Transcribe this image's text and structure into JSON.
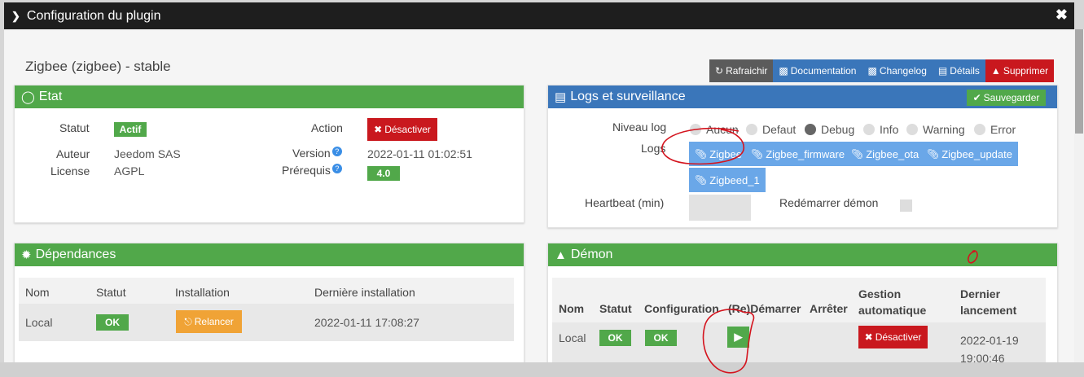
{
  "window": {
    "title": "Configuration du plugin",
    "close_icon": "close-icon"
  },
  "plugin": {
    "name": "Zigbee (zigbee) - stable"
  },
  "toolbar": {
    "refresh": "Rafraichir",
    "documentation": "Documentation",
    "changelog": "Changelog",
    "details": "Détails",
    "delete": "Supprimer"
  },
  "etat": {
    "title": "Etat",
    "statut_label": "Statut",
    "statut_value": "Actif",
    "auteur_label": "Auteur",
    "auteur_value": "Jeedom SAS",
    "license_label": "License",
    "license_value": "AGPL",
    "action_label": "Action",
    "action_button": "Désactiver",
    "version_label": "Version",
    "version_value": "2022-01-11 01:02:51",
    "prereq_label": "Prérequis",
    "prereq_value": "4.0"
  },
  "logs": {
    "title": "Logs et surveillance",
    "save": "Sauvegarder",
    "niveau_label": "Niveau log",
    "levels": [
      "Aucun",
      "Defaut",
      "Debug",
      "Info",
      "Warning",
      "Error"
    ],
    "selected_level": "Debug",
    "logs_label": "Logs",
    "log_buttons": [
      "Zigbee",
      "Zigbee_firmware",
      "Zigbee_ota",
      "Zigbee_update",
      "Zigbeed_1"
    ],
    "heartbeat_label": "Heartbeat (min)",
    "heartbeat_value": "",
    "restart_label": "Redémarrer démon"
  },
  "dependances": {
    "title": "Dépendances",
    "headers": [
      "Nom",
      "Statut",
      "Installation",
      "Dernière installation"
    ],
    "row": {
      "nom": "Local",
      "statut": "OK",
      "installation": "Relancer",
      "derniere": "2022-01-11 17:08:27"
    }
  },
  "demon": {
    "title": "Démon",
    "headers": [
      "Nom",
      "Statut",
      "Configuration",
      "(Re)Démarrer",
      "Arrêter",
      "Gestion automatique",
      "Dernier lancement"
    ],
    "row": {
      "nom": "Local",
      "statut": "OK",
      "configuration": "OK",
      "gestion": "Désactiver",
      "dernier": "2022-01-19 19:00:46"
    }
  },
  "colors": {
    "green": "#51a84a",
    "blue": "#3a76ba",
    "red": "#c9181e",
    "orange": "#f0a336",
    "light_blue": "#6aa7e8",
    "annotation": "#d4141e"
  }
}
